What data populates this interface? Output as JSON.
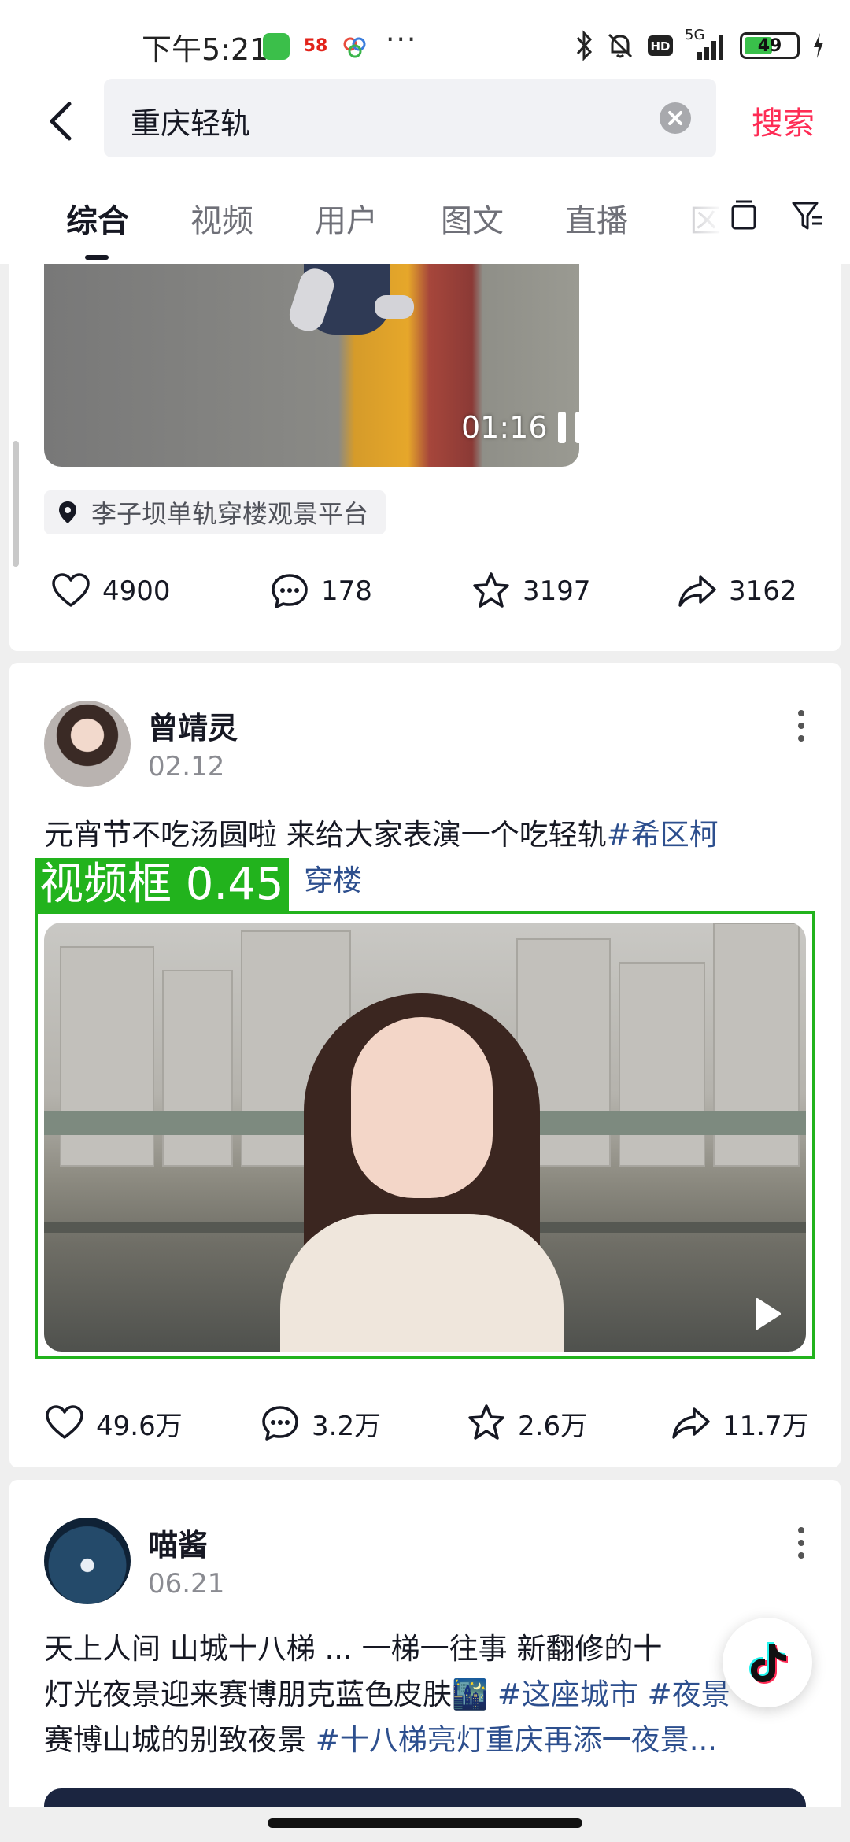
{
  "status_bar": {
    "time": "下午5:21",
    "app_58": "58",
    "dots": "···",
    "network": "5G",
    "battery": "49"
  },
  "header": {
    "query": "重庆轻轨",
    "search_label": "搜索"
  },
  "tabs": [
    {
      "label": "综合",
      "active": true
    },
    {
      "label": "视频"
    },
    {
      "label": "用户"
    },
    {
      "label": "图文"
    },
    {
      "label": "直播"
    },
    {
      "label": "区"
    }
  ],
  "post1": {
    "duration": "01:16",
    "location": "李子坝单轨穿楼观景平台",
    "likes": "4900",
    "comments": "178",
    "favorites": "3197",
    "shares": "3162"
  },
  "post2": {
    "author": "曾靖灵",
    "date": "02.12",
    "desc_text": "元宵节不吃汤圆啦 来给大家表演一个吃轻轨",
    "tag1": "#希区柯",
    "tag1_rest": "穿楼",
    "overlay_label": "视频框 0.45",
    "likes": "49.6万",
    "comments": "3.2万",
    "favorites": "2.6万",
    "shares": "11.7万"
  },
  "post3": {
    "author": "喵酱",
    "date": "06.21",
    "line1": "天上人间 山城十八梯 ... 一梯一往事 新翻修的十",
    "line2_text": "灯光夜景迎来赛博朋克蓝色皮肤🌃",
    "line2_tag1": " #这座城市",
    "line2_tag2": " #夜景",
    "line3_text": "赛博山城的别致夜景 ",
    "line3_tag": "#十八梯亮灯重庆再添一夜景..."
  },
  "colors": {
    "accent": "#fe2c55",
    "hashtag": "#2d4f8e",
    "detect_box": "#22b31d"
  },
  "icons": [
    "back-icon",
    "clear-icon",
    "layout-icon",
    "filter-icon",
    "pause-icon",
    "location-pin-icon",
    "heart-icon",
    "comment-icon",
    "star-icon",
    "share-icon",
    "more-icon",
    "play-icon",
    "tiktok-icon"
  ]
}
